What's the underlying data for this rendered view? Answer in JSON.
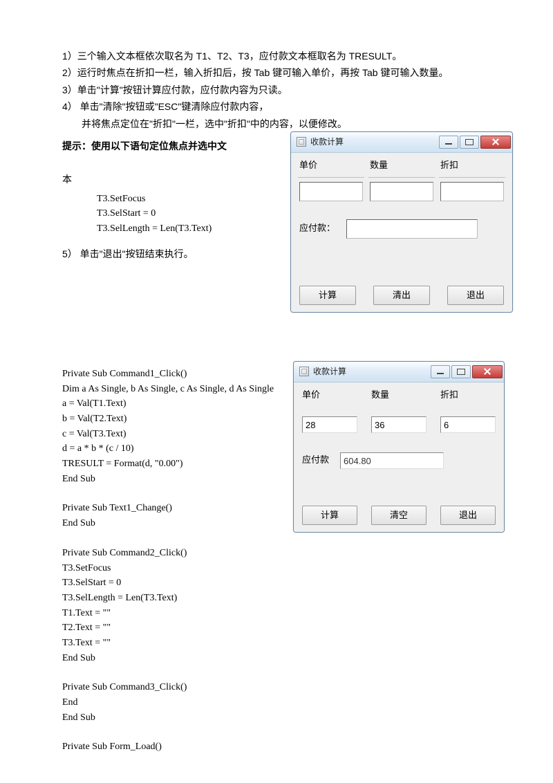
{
  "list": {
    "i1": "1）三个输入文本框依次取名为 T1、T2、T3，应付款文本框取名为 TRESULT。",
    "i2": "2）运行时焦点在折扣一栏，输入折扣后，按 Tab 键可输入单价，再按 Tab 键可输入数量。",
    "i3": "3）单击\"计算\"按钮计算应付款，应付款内容为只读。",
    "i4": "4） 单击\"清除\"按钮或\"ESC\"键清除应付款内容，",
    "i4b": "并将焦点定位在\"折扣\"一栏，选中\"折扣\"中的内容，以便修改。",
    "i5": "5） 单击\"退出\"按钮结束执行。"
  },
  "hint": "提示：使用以下语句定位焦点并选中文",
  "hint_cont": "本",
  "snippet": {
    "l1": "T3.SetFocus",
    "l2": "T3.SelStart = 0",
    "l3": "T3.SelLength = Len(T3.Text)"
  },
  "win1": {
    "title": "收款计算",
    "lbl_price": "单价",
    "lbl_qty": "数量",
    "lbl_disc": "折扣",
    "lbl_result": "应付款：",
    "val_price": "",
    "val_qty": "",
    "val_disc": "",
    "val_result": "",
    "btn_calc": "计算",
    "btn_clear": "清出",
    "btn_exit": "退出"
  },
  "win2": {
    "title": "收款计算",
    "lbl_price": "单价",
    "lbl_qty": "数量",
    "lbl_disc": "折扣",
    "lbl_result": "应付款",
    "val_price": "28",
    "val_qty": "36",
    "val_disc": "6",
    "val_result": "604.80",
    "btn_calc": "计算",
    "btn_clear": "清空",
    "btn_exit": "退出"
  },
  "code": {
    "c01": "Private Sub Command1_Click()",
    "c02": "Dim a As Single, b As Single, c As Single, d As Single",
    "c03": "a = Val(T1.Text)",
    "c04": "b = Val(T2.Text)",
    "c05": "c = Val(T3.Text)",
    "c06": "d = a * b * (c / 10)",
    "c07": "TRESULT = Format(d, \"0.00\")",
    "c08": "End Sub",
    "c09": "",
    "c10": "Private Sub Text1_Change()",
    "c11": "End Sub",
    "c12": "",
    "c13": "Private Sub Command2_Click()",
    "c14": "T3.SetFocus",
    "c15": "T3.SelStart = 0",
    "c16": "T3.SelLength = Len(T3.Text)",
    "c17": "T1.Text = \"\"",
    "c18": "T2.Text = \"\"",
    "c19": "T3.Text = \"\"",
    "c20": "End Sub",
    "c21": "",
    "c22": "Private Sub Command3_Click()",
    "c23": "End",
    "c24": "End Sub",
    "c25": "",
    "c26": "Private Sub Form_Load()"
  }
}
